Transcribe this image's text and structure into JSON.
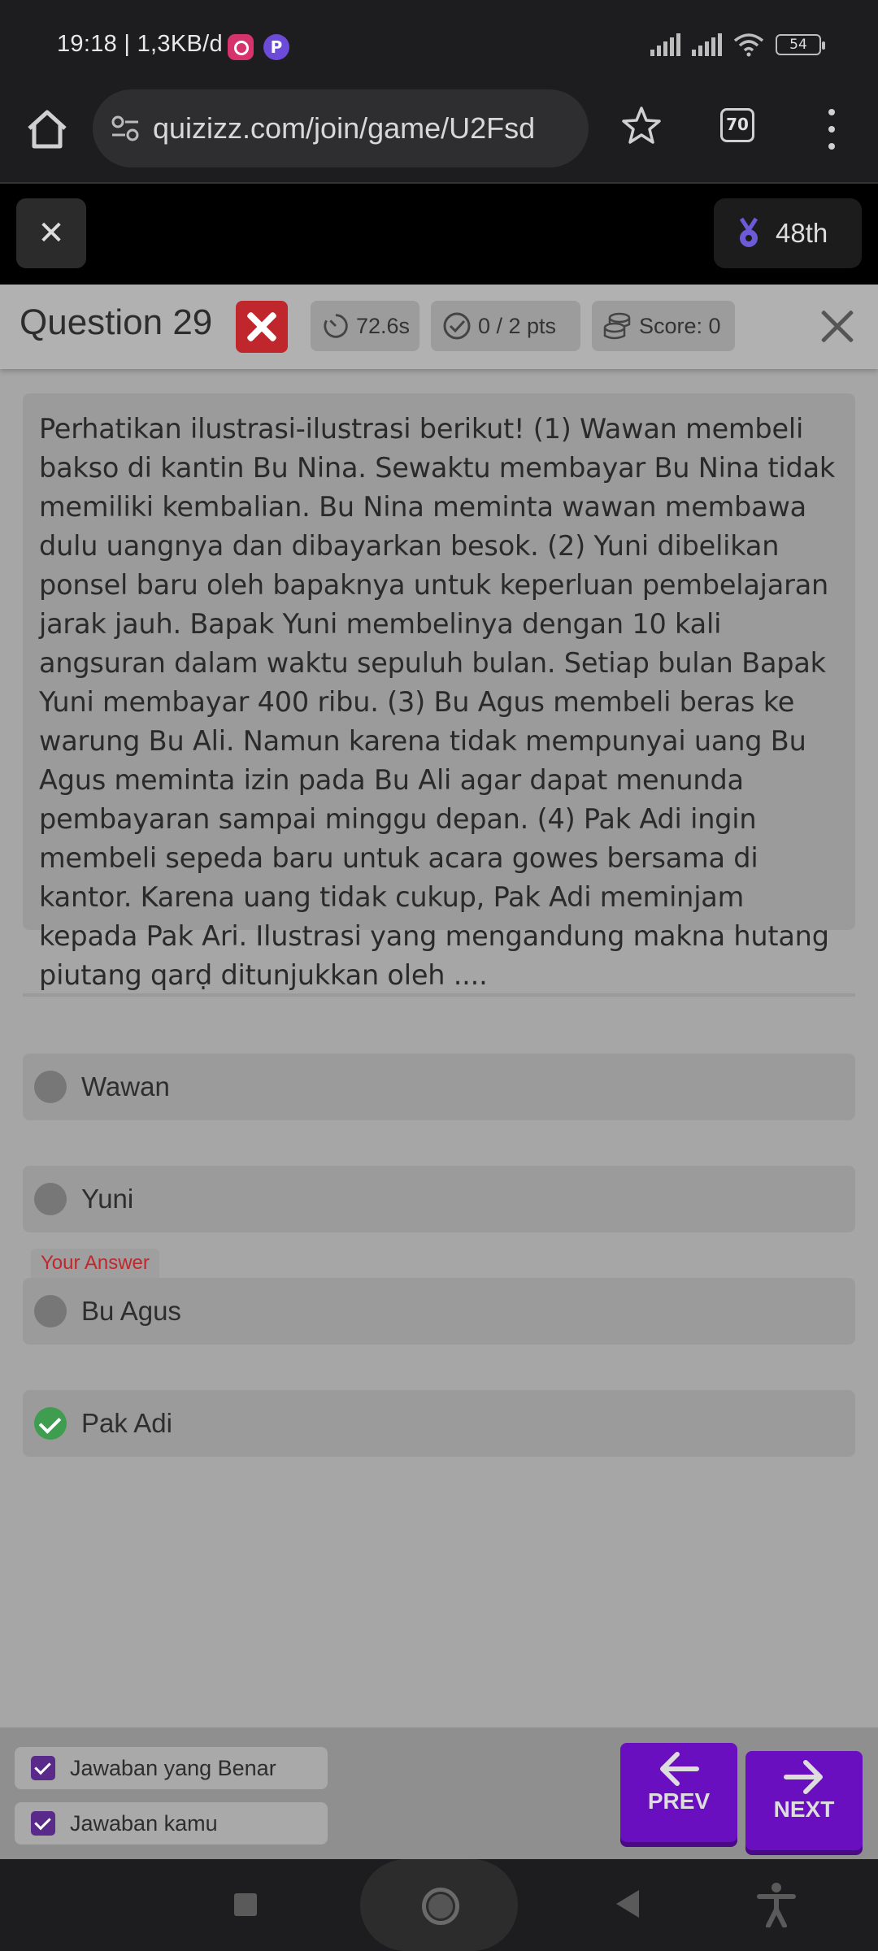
{
  "status_bar": {
    "time_speed": "19:18 | 1,3KB/d",
    "notification_icons": [
      "instagram-icon",
      "picsart-icon"
    ],
    "battery": "54"
  },
  "browser": {
    "url": "quizizz.com/join/game/U2Fsd",
    "tab_count": "70"
  },
  "quiz_header": {
    "close_label": "✕",
    "rank": "48th"
  },
  "question": {
    "title": "Question 29",
    "time": "72.6s",
    "points": "0 / 2 pts",
    "score": "Score: 0",
    "text": "Perhatikan ilustrasi-ilustrasi berikut! (1) Wawan membeli bakso di kantin Bu Nina. Sewaktu membayar Bu Nina tidak memiliki kembalian. Bu Nina meminta wawan membawa dulu uangnya dan dibayarkan besok. (2) Yuni dibelikan ponsel baru oleh bapaknya untuk keperluan pembelajaran jarak jauh. Bapak Yuni membelinya dengan 10 kali angsuran dalam waktu sepuluh bulan. Setiap bulan Bapak Yuni membayar 400 ribu. (3) Bu Agus membeli beras ke warung Bu Ali. Namun karena tidak mempunyai uang Bu Agus meminta izin pada Bu Ali agar dapat menunda pembayaran sampai minggu depan. (4) Pak Adi ingin membeli sepeda baru untuk acara gowes bersama di kantor. Karena uang tidak cukup, Pak Adi meminjam kepada Pak Ari. Ilustrasi yang mengandung makna hutang piutang qarḍ ditunjukkan oleh ...."
  },
  "options": [
    {
      "label": "Wawan",
      "state": "neutral"
    },
    {
      "label": "Yuni",
      "state": "neutral"
    },
    {
      "label": "Bu Agus",
      "state": "your-answer"
    },
    {
      "label": "Pak Adi",
      "state": "correct"
    }
  ],
  "your_answer_tag": "Your Answer",
  "legend": {
    "correct_label": "Jawaban yang Benar",
    "yours_label": "Jawaban kamu"
  },
  "nav": {
    "prev_label": "PREV",
    "next_label": "NEXT"
  },
  "colors": {
    "wrong": "#c0272d",
    "correct": "#3e9d4f",
    "primary": "#6a0fbf"
  }
}
